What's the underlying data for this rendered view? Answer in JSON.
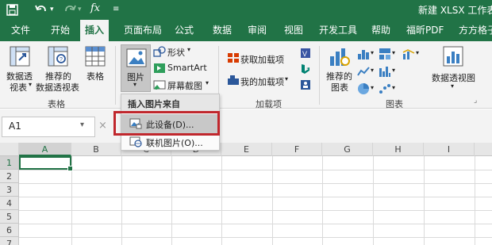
{
  "titlebar": {
    "title": "新建 XLSX 工作表.x",
    "icons": [
      "save-icon",
      "undo-icon",
      "redo-icon",
      "fx-icon",
      "customize-icon"
    ],
    "fx_label": "fx",
    "accent": "#217346"
  },
  "tabs": [
    "文件",
    "开始",
    "插入",
    "页面布局",
    "公式",
    "数据",
    "审阅",
    "视图",
    "开发工具",
    "帮助",
    "福昕PDF",
    "方方格子"
  ],
  "active_tab": "插入",
  "ribbon": {
    "tables_group": {
      "label": "表格",
      "pivot_line1": "数据透",
      "pivot_line2": "视表",
      "rec_pivot_line1": "推荐的",
      "rec_pivot_line2": "数据透视表",
      "table": "表格"
    },
    "illustrations": {
      "pictures": "图片",
      "shapes": "形状",
      "smartart": "SmartArt",
      "screenshot": "屏幕截图"
    },
    "addins_group": {
      "label": "加载项",
      "get_addins": "获取加载项",
      "my_addins": "我的加载项"
    },
    "charts_group": {
      "label": "图表",
      "recommended_line1": "推荐的",
      "recommended_line2": "图表",
      "pivot_chart": "数据透视图"
    }
  },
  "formula_bar": {
    "name_box": "A1",
    "cancel": "×"
  },
  "grid": {
    "columns": [
      "A",
      "B",
      "C",
      "D",
      "E",
      "F",
      "G",
      "H",
      "I"
    ],
    "rows": [
      "1",
      "2",
      "3",
      "4",
      "5",
      "6",
      "7"
    ],
    "selected_column": "A",
    "selected_row": "1"
  },
  "insert_picture_menu": {
    "header": "插入图片来自",
    "items": [
      "此设备(D)...",
      "联机图片(O)..."
    ],
    "highlight_color": "#c0272d"
  }
}
